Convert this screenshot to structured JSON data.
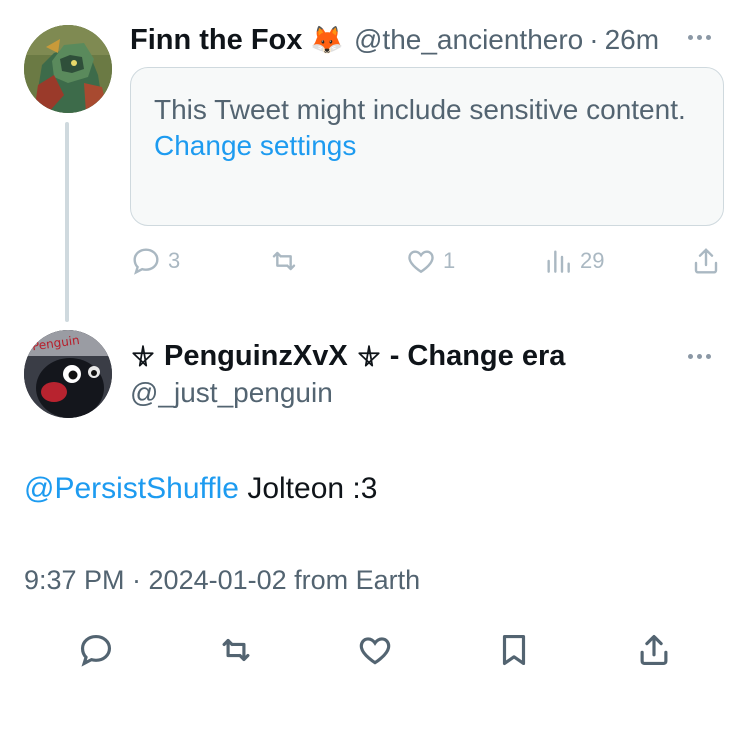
{
  "parent_tweet": {
    "display_name": "Finn the Fox",
    "name_emoji": "🦊",
    "handle": "@the_ancienthero",
    "separator": "·",
    "time": "26m",
    "sensitive_notice": "This Tweet might include sensitive content.",
    "settings_link": "Change settings",
    "actions": {
      "replies": "3",
      "retweets": "",
      "likes": "1",
      "views": "29"
    }
  },
  "main_tweet": {
    "display_name": "⛧ PenguinzXvX ⛧ - Change era",
    "name_prefix_symbol": "pentagram-icon",
    "name_core": "PenguinzXvX",
    "name_suffix": "- Change era",
    "handle": "@_just_penguin",
    "avatar_text": "Penguin",
    "mention": "@PersistShuffle",
    "text": " Jolteon :3",
    "timestamp": "9:37 PM · 2024-01-02 from Earth"
  },
  "colors": {
    "link": "#1d9bf0",
    "secondary_text": "#536471",
    "border": "#cfd9de"
  }
}
